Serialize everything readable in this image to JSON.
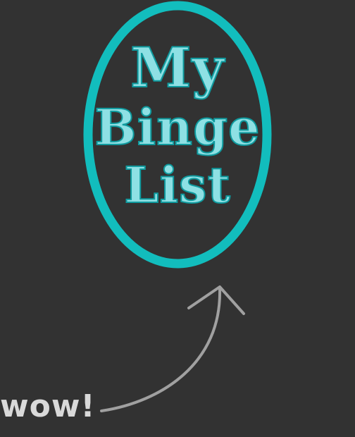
{
  "badge": {
    "line1": "My",
    "line2": "Binge",
    "line3": "List"
  },
  "annotation": {
    "label": "wow!"
  },
  "colors": {
    "background": "#323232",
    "ring": "#12bdbd",
    "text_fill": "#8ee0e4",
    "text_stroke": "#0f9a9e",
    "arrow": "#a0a0a0",
    "annotation_text": "#d9d9d9"
  }
}
